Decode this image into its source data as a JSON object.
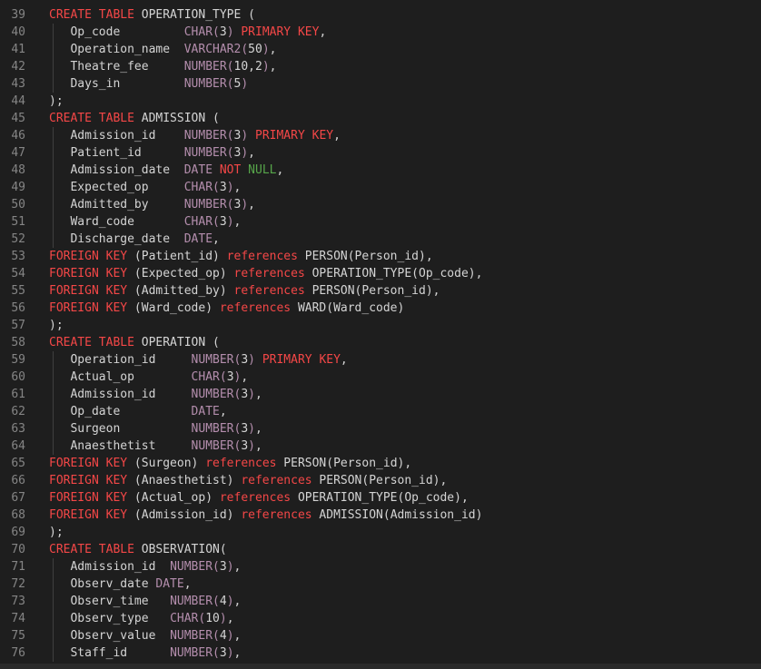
{
  "editor": {
    "colors": {
      "background": "#1e1e1e",
      "line_number": "#858585",
      "text": "#d4d4d4",
      "keyword": "#f44747",
      "type": "#b48ead",
      "null_literal": "#57a64a"
    },
    "lines": [
      {
        "num": "39",
        "tokens": [
          {
            "t": "CREATE TABLE ",
            "k": "kw"
          },
          {
            "t": "OPERATION_TYPE (",
            "k": "id"
          }
        ]
      },
      {
        "num": "40",
        "guide": true,
        "tokens": [
          {
            "t": "   Op_code         ",
            "k": "id"
          },
          {
            "t": "CHAR(",
            "k": "type"
          },
          {
            "t": "3",
            "k": "id"
          },
          {
            "t": ") ",
            "k": "type"
          },
          {
            "t": "PRIMARY KEY",
            "k": "kw"
          },
          {
            "t": ",",
            "k": "id"
          }
        ]
      },
      {
        "num": "41",
        "guide": true,
        "tokens": [
          {
            "t": "   Operation_name  ",
            "k": "id"
          },
          {
            "t": "VARCHAR2(",
            "k": "type"
          },
          {
            "t": "50",
            "k": "id"
          },
          {
            "t": ")",
            "k": "type"
          },
          {
            "t": ",",
            "k": "id"
          }
        ]
      },
      {
        "num": "42",
        "guide": true,
        "tokens": [
          {
            "t": "   Theatre_fee     ",
            "k": "id"
          },
          {
            "t": "NUMBER(",
            "k": "type"
          },
          {
            "t": "10,2",
            "k": "id"
          },
          {
            "t": ")",
            "k": "type"
          },
          {
            "t": ",",
            "k": "id"
          }
        ]
      },
      {
        "num": "43",
        "guide": true,
        "tokens": [
          {
            "t": "   Days_in         ",
            "k": "id"
          },
          {
            "t": "NUMBER(",
            "k": "type"
          },
          {
            "t": "5",
            "k": "id"
          },
          {
            "t": ")",
            "k": "type"
          }
        ]
      },
      {
        "num": "44",
        "tokens": [
          {
            "t": ");",
            "k": "id"
          }
        ]
      },
      {
        "num": "45",
        "tokens": [
          {
            "t": "CREATE TABLE ",
            "k": "kw"
          },
          {
            "t": "ADMISSION (",
            "k": "id"
          }
        ]
      },
      {
        "num": "46",
        "guide": true,
        "tokens": [
          {
            "t": "   Admission_id    ",
            "k": "id"
          },
          {
            "t": "NUMBER(",
            "k": "type"
          },
          {
            "t": "3",
            "k": "id"
          },
          {
            "t": ") ",
            "k": "type"
          },
          {
            "t": "PRIMARY KEY",
            "k": "kw"
          },
          {
            "t": ",",
            "k": "id"
          }
        ]
      },
      {
        "num": "47",
        "guide": true,
        "tokens": [
          {
            "t": "   Patient_id      ",
            "k": "id"
          },
          {
            "t": "NUMBER(",
            "k": "type"
          },
          {
            "t": "3",
            "k": "id"
          },
          {
            "t": ")",
            "k": "type"
          },
          {
            "t": ",",
            "k": "id"
          }
        ]
      },
      {
        "num": "48",
        "guide": true,
        "tokens": [
          {
            "t": "   Admission_date  ",
            "k": "id"
          },
          {
            "t": "DATE ",
            "k": "type"
          },
          {
            "t": "NOT ",
            "k": "kw"
          },
          {
            "t": "NULL",
            "k": "null"
          },
          {
            "t": ",",
            "k": "id"
          }
        ]
      },
      {
        "num": "49",
        "guide": true,
        "tokens": [
          {
            "t": "   Expected_op     ",
            "k": "id"
          },
          {
            "t": "CHAR(",
            "k": "type"
          },
          {
            "t": "3",
            "k": "id"
          },
          {
            "t": ")",
            "k": "type"
          },
          {
            "t": ",",
            "k": "id"
          }
        ]
      },
      {
        "num": "50",
        "guide": true,
        "tokens": [
          {
            "t": "   Admitted_by     ",
            "k": "id"
          },
          {
            "t": "NUMBER(",
            "k": "type"
          },
          {
            "t": "3",
            "k": "id"
          },
          {
            "t": ")",
            "k": "type"
          },
          {
            "t": ",",
            "k": "id"
          }
        ]
      },
      {
        "num": "51",
        "guide": true,
        "tokens": [
          {
            "t": "   Ward_code       ",
            "k": "id"
          },
          {
            "t": "CHAR(",
            "k": "type"
          },
          {
            "t": "3",
            "k": "id"
          },
          {
            "t": ")",
            "k": "type"
          },
          {
            "t": ",",
            "k": "id"
          }
        ]
      },
      {
        "num": "52",
        "guide": true,
        "tokens": [
          {
            "t": "   Discharge_date  ",
            "k": "id"
          },
          {
            "t": "DATE",
            "k": "type"
          },
          {
            "t": ",",
            "k": "id"
          }
        ]
      },
      {
        "num": "53",
        "tokens": [
          {
            "t": "FOREIGN KEY ",
            "k": "kw"
          },
          {
            "t": "(Patient_id) ",
            "k": "id"
          },
          {
            "t": "references ",
            "k": "kw"
          },
          {
            "t": "PERSON(Person_id),",
            "k": "id"
          }
        ]
      },
      {
        "num": "54",
        "tokens": [
          {
            "t": "FOREIGN KEY ",
            "k": "kw"
          },
          {
            "t": "(Expected_op) ",
            "k": "id"
          },
          {
            "t": "references ",
            "k": "kw"
          },
          {
            "t": "OPERATION_TYPE(Op_code),",
            "k": "id"
          }
        ]
      },
      {
        "num": "55",
        "tokens": [
          {
            "t": "FOREIGN KEY ",
            "k": "kw"
          },
          {
            "t": "(Admitted_by) ",
            "k": "id"
          },
          {
            "t": "references ",
            "k": "kw"
          },
          {
            "t": "PERSON(Person_id),",
            "k": "id"
          }
        ]
      },
      {
        "num": "56",
        "tokens": [
          {
            "t": "FOREIGN KEY ",
            "k": "kw"
          },
          {
            "t": "(Ward_code) ",
            "k": "id"
          },
          {
            "t": "references ",
            "k": "kw"
          },
          {
            "t": "WARD(Ward_code)",
            "k": "id"
          }
        ]
      },
      {
        "num": "57",
        "tokens": [
          {
            "t": ");",
            "k": "id"
          }
        ]
      },
      {
        "num": "58",
        "tokens": [
          {
            "t": "CREATE TABLE ",
            "k": "kw"
          },
          {
            "t": "OPERATION (",
            "k": "id"
          }
        ]
      },
      {
        "num": "59",
        "guide": true,
        "tokens": [
          {
            "t": "   Operation_id     ",
            "k": "id"
          },
          {
            "t": "NUMBER(",
            "k": "type"
          },
          {
            "t": "3",
            "k": "id"
          },
          {
            "t": ") ",
            "k": "type"
          },
          {
            "t": "PRIMARY KEY",
            "k": "kw"
          },
          {
            "t": ",",
            "k": "id"
          }
        ]
      },
      {
        "num": "60",
        "guide": true,
        "tokens": [
          {
            "t": "   Actual_op        ",
            "k": "id"
          },
          {
            "t": "CHAR(",
            "k": "type"
          },
          {
            "t": "3",
            "k": "id"
          },
          {
            "t": ")",
            "k": "type"
          },
          {
            "t": ",",
            "k": "id"
          }
        ]
      },
      {
        "num": "61",
        "guide": true,
        "tokens": [
          {
            "t": "   Admission_id     ",
            "k": "id"
          },
          {
            "t": "NUMBER(",
            "k": "type"
          },
          {
            "t": "3",
            "k": "id"
          },
          {
            "t": ")",
            "k": "type"
          },
          {
            "t": ",",
            "k": "id"
          }
        ]
      },
      {
        "num": "62",
        "guide": true,
        "tokens": [
          {
            "t": "   Op_date          ",
            "k": "id"
          },
          {
            "t": "DATE",
            "k": "type"
          },
          {
            "t": ",",
            "k": "id"
          }
        ]
      },
      {
        "num": "63",
        "guide": true,
        "tokens": [
          {
            "t": "   Surgeon          ",
            "k": "id"
          },
          {
            "t": "NUMBER(",
            "k": "type"
          },
          {
            "t": "3",
            "k": "id"
          },
          {
            "t": ")",
            "k": "type"
          },
          {
            "t": ",",
            "k": "id"
          }
        ]
      },
      {
        "num": "64",
        "guide": true,
        "tokens": [
          {
            "t": "   Anaesthetist     ",
            "k": "id"
          },
          {
            "t": "NUMBER(",
            "k": "type"
          },
          {
            "t": "3",
            "k": "id"
          },
          {
            "t": ")",
            "k": "type"
          },
          {
            "t": ",",
            "k": "id"
          }
        ]
      },
      {
        "num": "65",
        "tokens": [
          {
            "t": "FOREIGN KEY ",
            "k": "kw"
          },
          {
            "t": "(Surgeon) ",
            "k": "id"
          },
          {
            "t": "references ",
            "k": "kw"
          },
          {
            "t": "PERSON(Person_id),",
            "k": "id"
          }
        ]
      },
      {
        "num": "66",
        "tokens": [
          {
            "t": "FOREIGN KEY ",
            "k": "kw"
          },
          {
            "t": "(Anaesthetist) ",
            "k": "id"
          },
          {
            "t": "references ",
            "k": "kw"
          },
          {
            "t": "PERSON(Person_id),",
            "k": "id"
          }
        ]
      },
      {
        "num": "67",
        "tokens": [
          {
            "t": "FOREIGN KEY ",
            "k": "kw"
          },
          {
            "t": "(Actual_op) ",
            "k": "id"
          },
          {
            "t": "references ",
            "k": "kw"
          },
          {
            "t": "OPERATION_TYPE(Op_code),",
            "k": "id"
          }
        ]
      },
      {
        "num": "68",
        "tokens": [
          {
            "t": "FOREIGN KEY ",
            "k": "kw"
          },
          {
            "t": "(Admission_id) ",
            "k": "id"
          },
          {
            "t": "references ",
            "k": "kw"
          },
          {
            "t": "ADMISSION(Admission_id)",
            "k": "id"
          }
        ]
      },
      {
        "num": "69",
        "tokens": [
          {
            "t": ");",
            "k": "id"
          }
        ]
      },
      {
        "num": "70",
        "tokens": [
          {
            "t": "CREATE TABLE ",
            "k": "kw"
          },
          {
            "t": "OBSERVATION(",
            "k": "id"
          }
        ]
      },
      {
        "num": "71",
        "guide": true,
        "tokens": [
          {
            "t": "   Admission_id  ",
            "k": "id"
          },
          {
            "t": "NUMBER(",
            "k": "type"
          },
          {
            "t": "3",
            "k": "id"
          },
          {
            "t": ")",
            "k": "type"
          },
          {
            "t": ",",
            "k": "id"
          }
        ]
      },
      {
        "num": "72",
        "guide": true,
        "tokens": [
          {
            "t": "   Observ_date ",
            "k": "id"
          },
          {
            "t": "DATE",
            "k": "type"
          },
          {
            "t": ",",
            "k": "id"
          }
        ]
      },
      {
        "num": "73",
        "guide": true,
        "tokens": [
          {
            "t": "   Observ_time   ",
            "k": "id"
          },
          {
            "t": "NUMBER(",
            "k": "type"
          },
          {
            "t": "4",
            "k": "id"
          },
          {
            "t": ")",
            "k": "type"
          },
          {
            "t": ",",
            "k": "id"
          }
        ]
      },
      {
        "num": "74",
        "guide": true,
        "tokens": [
          {
            "t": "   Observ_type   ",
            "k": "id"
          },
          {
            "t": "CHAR(",
            "k": "type"
          },
          {
            "t": "10",
            "k": "id"
          },
          {
            "t": ")",
            "k": "type"
          },
          {
            "t": ",",
            "k": "id"
          }
        ]
      },
      {
        "num": "75",
        "guide": true,
        "tokens": [
          {
            "t": "   Observ_value  ",
            "k": "id"
          },
          {
            "t": "NUMBER(",
            "k": "type"
          },
          {
            "t": "4",
            "k": "id"
          },
          {
            "t": ")",
            "k": "type"
          },
          {
            "t": ",",
            "k": "id"
          }
        ]
      },
      {
        "num": "76",
        "guide": true,
        "tokens": [
          {
            "t": "   Staff_id      ",
            "k": "id"
          },
          {
            "t": "NUMBER(",
            "k": "type"
          },
          {
            "t": "3",
            "k": "id"
          },
          {
            "t": ")",
            "k": "type"
          },
          {
            "t": ",",
            "k": "id"
          }
        ]
      }
    ]
  }
}
